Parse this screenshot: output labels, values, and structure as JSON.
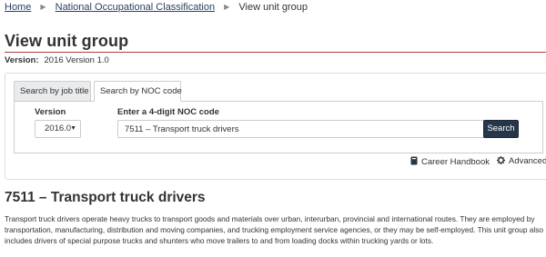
{
  "breadcrumb": {
    "home": "Home",
    "noc": "National Occupational Classification",
    "current": "View unit group",
    "separator": ">"
  },
  "page": {
    "title": "View unit group",
    "version_label": "Version:",
    "version_value": "2016 Version 1.0"
  },
  "search": {
    "tabs": [
      {
        "label": "Search by job title",
        "active": false
      },
      {
        "label": "Search by NOC code",
        "active": true
      }
    ],
    "version_label": "Version",
    "version_selected": "2016.0",
    "noc_label": "Enter a 4-digit NOC code",
    "noc_value": "7511 – Transport truck drivers",
    "search_button": "Search"
  },
  "links": {
    "career_handbook": "Career Handbook",
    "advanced": "Advanced"
  },
  "unit_group": {
    "title": "7511 – Transport truck drivers",
    "description": "Transport truck drivers operate heavy trucks to transport goods and materials over urban, interurban, provincial and international routes. They are employed by transportation, manufacturing, distribution and moving companies, and trucking employment service agencies, or they may be self-employed. This unit group also includes drivers of special purpose trucks and shunters who move trailers to and from loading docks within trucking yards or lots."
  },
  "colors": {
    "title_rule": "#af3c43",
    "link": "#284162",
    "button": "#26374a"
  },
  "icons": [
    "chevron-right-icon",
    "chevron-down-icon",
    "book-icon",
    "gear-icon"
  ]
}
